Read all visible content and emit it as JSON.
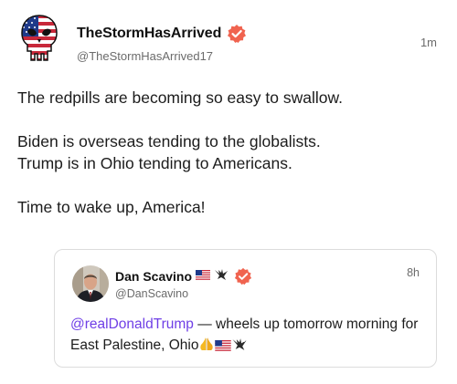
{
  "post": {
    "author_name": "TheStormHasArrived",
    "author_handle": "@TheStormHasArrived17",
    "timestamp": "1m",
    "body": [
      "The redpills are becoming so easy to swallow.",
      "Biden is overseas tending to the globalists.",
      "Trump is in Ohio tending to Americans.",
      "Time to wake up, America!"
    ]
  },
  "quoted": {
    "author_name": "Dan Scavino",
    "author_handle": "@DanScavino",
    "timestamp": "8h",
    "mention": "@realDonaldTrump",
    "text": " — wheels up tomorrow morning for East Palestine, Ohio"
  },
  "colors": {
    "verified_badge": "#f0634f",
    "mention": "#6f3fe6"
  },
  "icons": [
    "punisher-flag-avatar",
    "verified-badge-icon",
    "us-flag-emoji",
    "eagle-emoji",
    "folded-hands-emoji"
  ]
}
